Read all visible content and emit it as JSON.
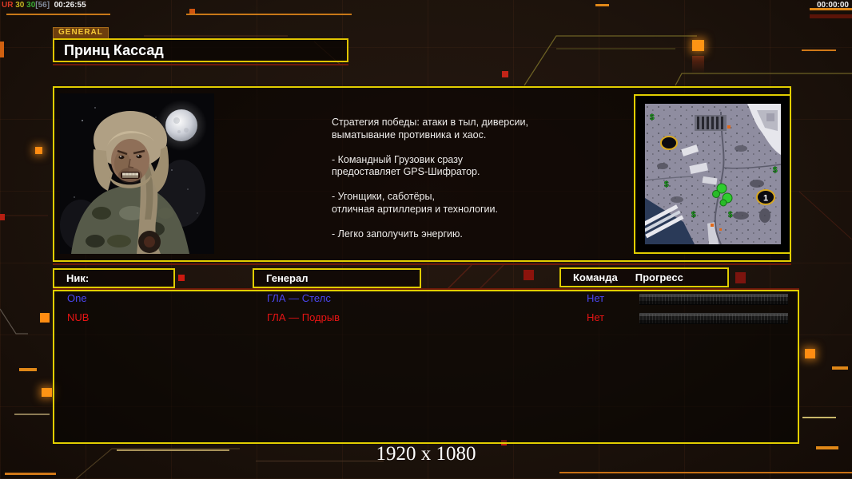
{
  "hud": {
    "debug_segments": [
      {
        "text": "UR ",
        "color": "#d93a26"
      },
      {
        "text": "30 ",
        "color": "#c8b822"
      },
      {
        "text": "30",
        "color": "#3aab36"
      },
      {
        "text": "[56] ",
        "color": "#7f8899"
      },
      {
        "text": " 00:26:55",
        "color": "#eeeeee"
      }
    ],
    "clock": "00:00:00"
  },
  "header": {
    "tag": "GENERAL",
    "title": "Принц Кассад"
  },
  "briefing": {
    "strategy_text": "Стратегия победы: атаки в тыл, диверсии,\n выматывание противника и хаос.\n\n- Командный Грузовик сразу\nпредоставляет GPS-Шифратор.\n\n- Угонщики, саботёры,\nотличная артиллерия и технологии.\n\n- Легко заполучить энергию."
  },
  "minimap": {
    "start_marker_label": "1",
    "money_marker": "$"
  },
  "lobby": {
    "columns": {
      "nick": "Ник:",
      "general": "Генерал",
      "team": "Команда",
      "progress": "Прогресс"
    },
    "players": [
      {
        "name": "One",
        "general": "ГЛА — Стелс",
        "team": "Нет",
        "color": "#4a47f0"
      },
      {
        "name": "NUB",
        "general": "ГЛА — Подрыв",
        "team": "Нет",
        "color": "#e81414"
      }
    ]
  },
  "footer": {
    "resolution": "1920 x 1080"
  },
  "colors": {
    "panel_border": "#e2ce00",
    "accent_orange": "#ff9414",
    "decor_red": "#c02014"
  }
}
